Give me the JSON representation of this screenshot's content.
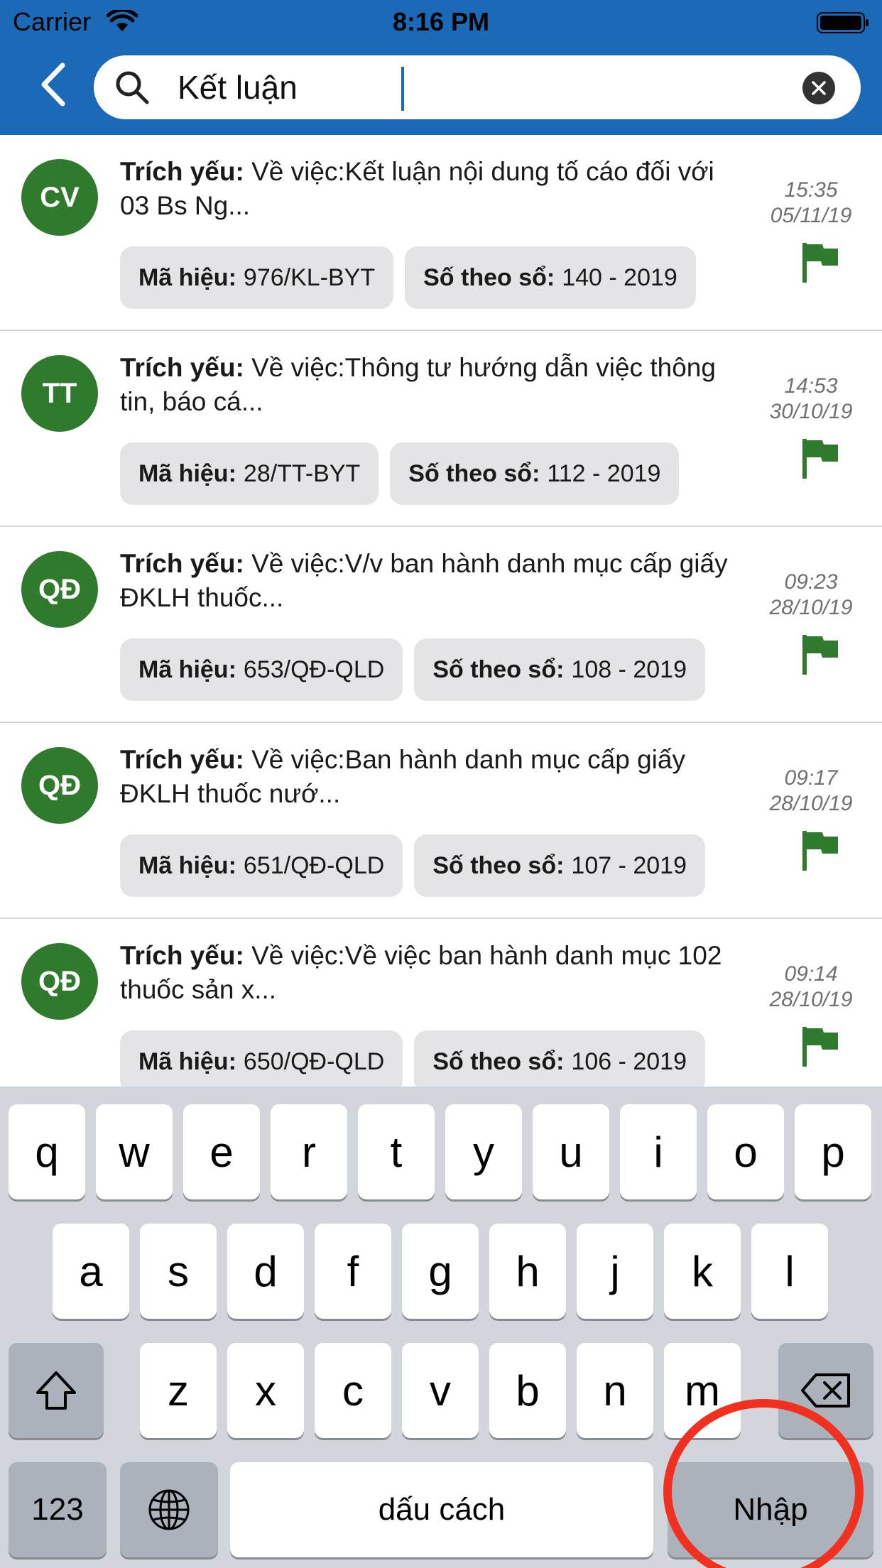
{
  "status_bar": {
    "carrier": "Carrier",
    "time": "8:16 PM"
  },
  "search": {
    "value": "Kết luận"
  },
  "colors": {
    "header": "#1a6ab8",
    "avatar": "#2f7a2c",
    "flag": "#2f7a2c",
    "annotation_ring": "#f1301f"
  },
  "labels": {
    "summary": "Trích yếu:",
    "code": "Mã hiệu:",
    "number": "Số theo sổ:"
  },
  "documents": [
    {
      "avatar": "CV",
      "summary": "Về việc:Kết luận nội dung tố cáo đối với 03 Bs Ng...",
      "code": "976/KL-BYT",
      "number": "140 - 2019",
      "time": "15:35",
      "date": "05/11/19",
      "icon": "flag-icon"
    },
    {
      "avatar": "TT",
      "summary": "Về việc:Thông tư hướng dẫn việc thông tin, báo cá...",
      "code": "28/TT-BYT",
      "number": "112 - 2019",
      "time": "14:53",
      "date": "30/10/19",
      "icon": "flag-icon"
    },
    {
      "avatar": "QĐ",
      "summary": "Về việc:V/v ban hành danh mục cấp giấy ĐKLH thuốc...",
      "code": "653/QĐ-QLD",
      "number": "108 - 2019",
      "time": "09:23",
      "date": "28/10/19",
      "icon": "flag-icon"
    },
    {
      "avatar": "QĐ",
      "summary": "Về việc:Ban hành danh mục cấp giấy ĐKLH thuốc nướ...",
      "code": "651/QĐ-QLD",
      "number": "107 - 2019",
      "time": "09:17",
      "date": "28/10/19",
      "icon": "flag-icon"
    },
    {
      "avatar": "QĐ",
      "summary": "Về việc:Về việc ban hành danh mục 102 thuốc sản x...",
      "code": "650/QĐ-QLD",
      "number": "106 - 2019",
      "time": "09:14",
      "date": "28/10/19",
      "icon": "flag-icon"
    }
  ],
  "keyboard": {
    "row1": [
      "q",
      "w",
      "e",
      "r",
      "t",
      "y",
      "u",
      "i",
      "o",
      "p"
    ],
    "row2": [
      "a",
      "s",
      "d",
      "f",
      "g",
      "h",
      "j",
      "k",
      "l"
    ],
    "row3": [
      "z",
      "x",
      "c",
      "v",
      "b",
      "n",
      "m"
    ],
    "numbers_key": "123",
    "space_key": "dấu cách",
    "return_key": "Nhập",
    "icons": {
      "shift": "shift-icon",
      "delete": "delete-icon",
      "globe": "globe-icon"
    }
  }
}
